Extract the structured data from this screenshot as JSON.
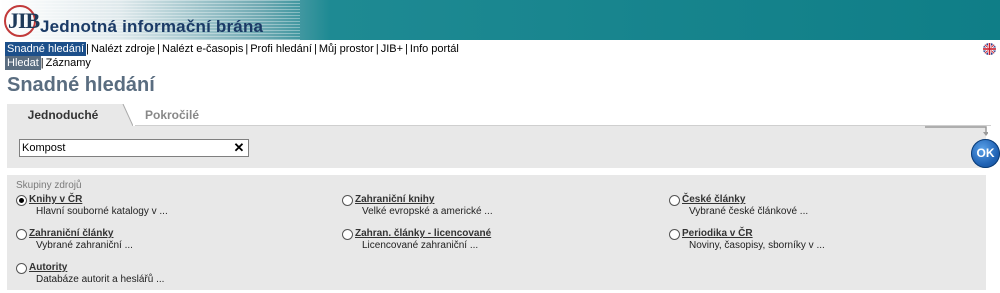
{
  "banner": {
    "logo_text": "JIB",
    "title": "Jednotná informační brána"
  },
  "topnav": [
    {
      "label": "Snadné hledání",
      "active": true
    },
    {
      "label": "Nalézt zdroje",
      "active": false
    },
    {
      "label": "Nalézt e-časopis",
      "active": false
    },
    {
      "label": "Profi hledání",
      "active": false
    },
    {
      "label": "Můj prostor",
      "active": false
    },
    {
      "label": "JIB+",
      "active": false
    },
    {
      "label": "Info portál",
      "active": false
    }
  ],
  "language_flag": "uk-flag-icon",
  "subnav": [
    {
      "label": "Hledat",
      "active": true
    },
    {
      "label": "Záznamy",
      "active": false
    }
  ],
  "page_title": "Snadné hledání",
  "tabs": [
    {
      "label": "Jednoduché",
      "active": true
    },
    {
      "label": "Pokročilé",
      "active": false
    }
  ],
  "search": {
    "value": "Kompost",
    "placeholder": "",
    "clear_label": "✕",
    "submit_label": "OK"
  },
  "groups": {
    "label": "Skupiny zdrojů",
    "options": [
      {
        "name": "Knihy v ČR",
        "desc": "Hlavní souborné katalogy v ...",
        "checked": true
      },
      {
        "name": "Zahraniční knihy",
        "desc": "Velké evropské a americké ...",
        "checked": false
      },
      {
        "name": "České články",
        "desc": "Vybrané české článkové ...",
        "checked": false
      },
      {
        "name": "Zahraniční články",
        "desc": "Vybrané zahraniční ...",
        "checked": false
      },
      {
        "name": "Zahran. články - licencované",
        "desc": "Licencované zahraniční ...",
        "checked": false
      },
      {
        "name": "Periodika v ČR",
        "desc": "Noviny, časopisy, sborníky v ...",
        "checked": false
      },
      {
        "name": "Autority",
        "desc": "Databáze autorit a heslářů ...",
        "checked": false
      }
    ]
  },
  "colors": {
    "banner_teal": "#0f7e87",
    "nav_active": "#1c4f8a",
    "subnav_active": "#5a6d80",
    "panel_gray": "#e8e8e8",
    "ok_blue": "#1f62b4"
  }
}
